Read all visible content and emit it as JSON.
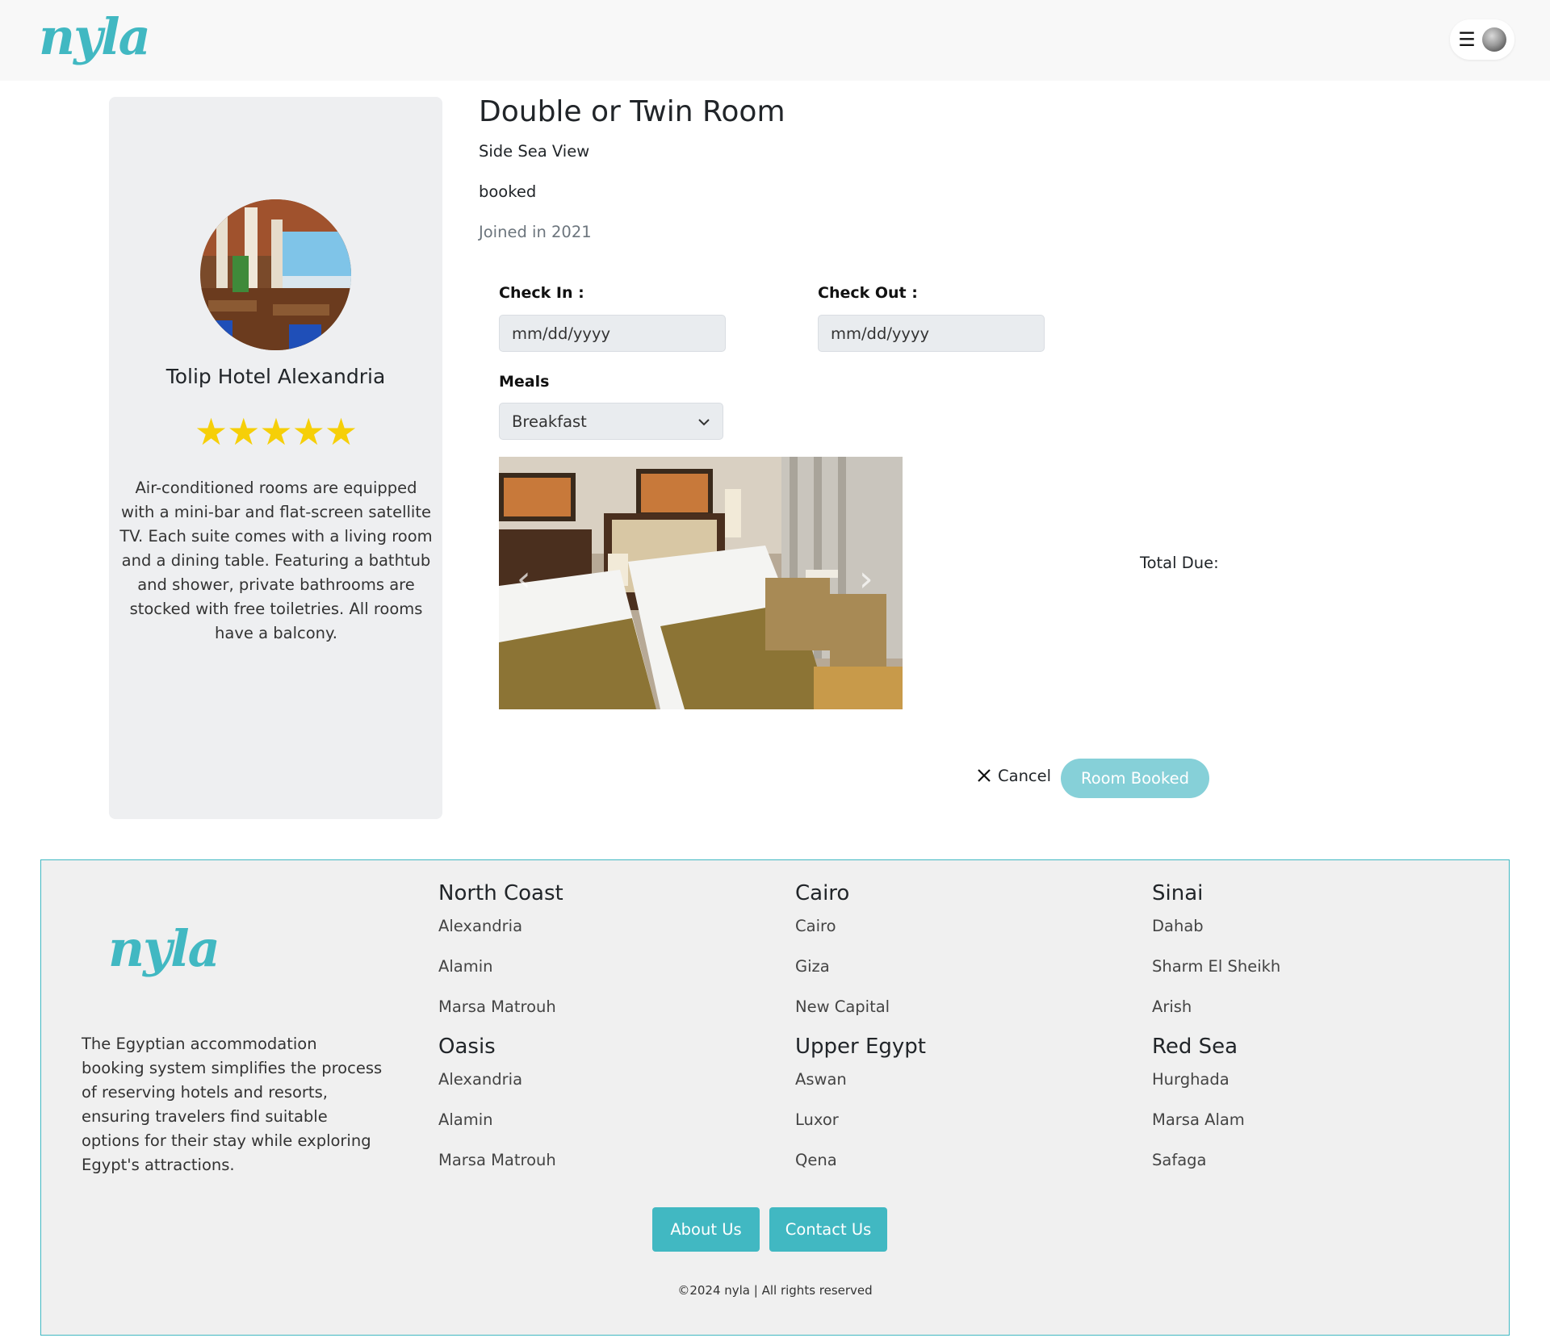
{
  "brand": {
    "logo_text": "nyla",
    "accent_color": "#41b8c2"
  },
  "header": {
    "menu_icon": "hamburger-icon",
    "avatar": "user-avatar"
  },
  "hotel": {
    "name": "Tolip Hotel Alexandria",
    "rating_stars": 5,
    "stars_text": "★★★★★",
    "description": "Air-conditioned rooms are equipped with a mini-bar and flat-screen satellite TV. Each suite comes with a living room and a dining table. Featuring a bathtub and shower, private bathrooms are stocked with free toiletries. All rooms have a balcony."
  },
  "room": {
    "title": "Double or Twin Room",
    "view": "Side Sea View",
    "status": "booked",
    "joined": "Joined in 2021"
  },
  "booking": {
    "check_in_label": "Check In :",
    "check_in_placeholder": "mm/dd/yyyy",
    "check_out_label": "Check Out :",
    "check_out_placeholder": "mm/dd/yyyy",
    "meals_label": "Meals",
    "meals_selected": "Breakfast",
    "total_label": "Total Due:",
    "cancel_label": "Cancel",
    "booked_label": "Room Booked"
  },
  "footer": {
    "description": "The Egyptian accommodation booking system simplifies the process of reserving hotels and resorts, ensuring travelers find suitable options for their stay while exploring Egypt's attractions.",
    "columns": [
      {
        "title": "North Coast",
        "links": [
          "Alexandria",
          "Alamin",
          "Marsa Matrouh"
        ]
      },
      {
        "title": "Cairo",
        "links": [
          "Cairo",
          "Giza",
          "New Capital"
        ]
      },
      {
        "title": "Sinai",
        "links": [
          "Dahab",
          "Sharm El Sheikh",
          "Arish"
        ]
      },
      {
        "title": "Oasis",
        "links": [
          "Alexandria",
          "Alamin",
          "Marsa Matrouh"
        ]
      },
      {
        "title": "Upper Egypt",
        "links": [
          "Aswan",
          "Luxor",
          "Qena"
        ]
      },
      {
        "title": "Red Sea",
        "links": [
          "Hurghada",
          "Marsa Alam",
          "Safaga"
        ]
      }
    ],
    "about_label": "About Us",
    "contact_label": "Contact Us",
    "copyright": "©2024 nyla | All rights reserved"
  }
}
